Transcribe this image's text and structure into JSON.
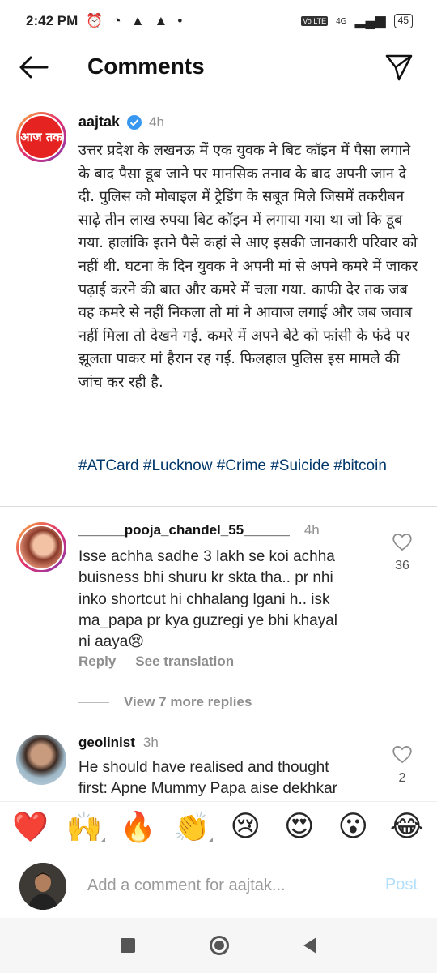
{
  "status_bar": {
    "time": "2:42 PM",
    "network": "4G",
    "lte": "Vo LTE",
    "battery": "45"
  },
  "header": {
    "title": "Comments"
  },
  "caption": {
    "username": "aajtak",
    "time": "4h",
    "text": "उत्तर प्रदेश के लखनऊ में एक युवक ने बिट कॉइन में पैसा लगाने के बाद पैसा डूब जाने पर मानसिक तनाव के बाद अपनी जान दे दी. पुलिस को मोबाइल में ट्रेडिंग के सबूत मिले जिसमें तकरीबन साढ़े तीन लाख रुपया बिट कॉइन में लगाया गया था जो कि डूब गया. हालांकि इतने पैसे कहां से आए इसकी जानकारी परिवार को नहीं थी. घटना के दिन युवक ने अपनी मां से अपने कमरे में जाकर पढ़ाई करने की बात और कमरे में चला गया. काफी देर तक जब वह कमरे से नहीं निकला तो मां ने आवाज लगाई और जब जवाब नहीं मिला तो देखने गई. कमरे में अपने बेटे को फांसी के फंदे पर झूलता पाकर मां हैरान रह गई. फिलहाल पुलिस इस मामले की जांच कर रही है.",
    "hashtags": "#ATCard #Lucknow #Crime #Suicide #bitcoin",
    "logo_text": "आज तक"
  },
  "comments": [
    {
      "username": "______pooja_chandel_55______",
      "time": "4h",
      "text": "Isse achha sadhe 3 lakh se koi achha buisness bhi shuru kr skta tha.. pr nhi inko shortcut hi chhalang lgani h.. isk ma_papa pr kya guzregi ye bhi khayal ni aaya😢",
      "likes": "36",
      "reply_label": "Reply",
      "translate_label": "See translation",
      "view_replies": "View 7 more replies"
    },
    {
      "username": "geolinist",
      "time": "3h",
      "text": "He should have realised and thought first: Apne Mummy Papa aise dekhkar",
      "likes": "2"
    }
  ],
  "emoji_bar": [
    "❤️",
    "🙌",
    "🔥",
    "👏",
    "😢",
    "😍",
    "😮",
    "😂"
  ],
  "composer": {
    "placeholder": "Add a comment for aajtak...",
    "post_label": "Post"
  },
  "colors": {
    "hashtag": "#00376b",
    "post_disabled": "#b2dffc",
    "verified": "#3897f0",
    "aajtak_red": "#e52320"
  }
}
